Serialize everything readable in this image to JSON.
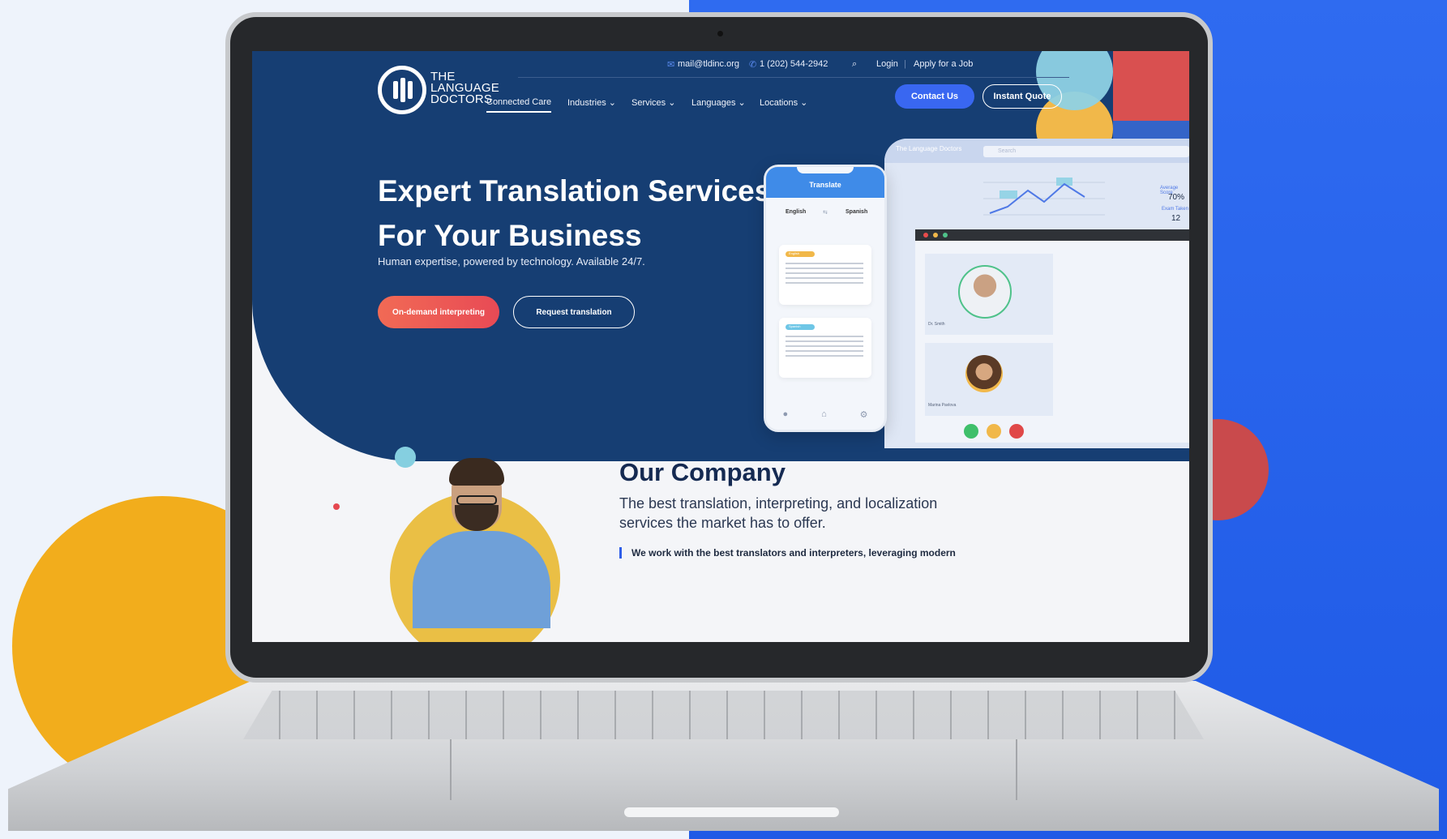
{
  "topbar": {
    "email": "mail@tldinc.org",
    "phone": "1 (202) 544-2942",
    "login": "Login",
    "apply": "Apply for a Job"
  },
  "logo": {
    "line1": "THE",
    "line2": "LANGUAGE",
    "line3": "DOCTORS"
  },
  "nav": {
    "items": [
      "Connected Care",
      "Industries",
      "Services",
      "Languages",
      "Locations"
    ],
    "contact": "Contact Us",
    "quote": "Instant Quote"
  },
  "hero": {
    "title_line1": "Expert Translation Services",
    "title_line2": "For Your Business",
    "subtitle": "Human expertise, powered by technology. Available 24/7.",
    "cta_primary": "On-demand interpreting",
    "cta_secondary": "Request translation"
  },
  "mockup": {
    "dash_brand": "The Language Doctors",
    "dash_search": "Search",
    "avg_score_label": "Average Score",
    "avg_score": "70%",
    "exam_label": "Exam Taken",
    "exam_count": "12",
    "phone_header": "Translate",
    "lang_from": "English",
    "lang_to": "Spanish",
    "card1_tag": "English",
    "card2_tag": "Spanish",
    "doctor_name": "Dr. Smith",
    "patient_name": "Marina Pavlova"
  },
  "company": {
    "title": "Our Company",
    "subtitle": "The best translation, interpreting, and localization services the market has to offer.",
    "quote": "We work with the best translators and interpreters, leveraging modern"
  },
  "colors": {
    "hero_bg": "#163e73",
    "accent_blue": "#3967f1",
    "cta_red": "#e84a55",
    "deco_yellow": "#f2ad1c",
    "deco_red": "#c94a4c",
    "page_blue": "#2f6bf0"
  }
}
